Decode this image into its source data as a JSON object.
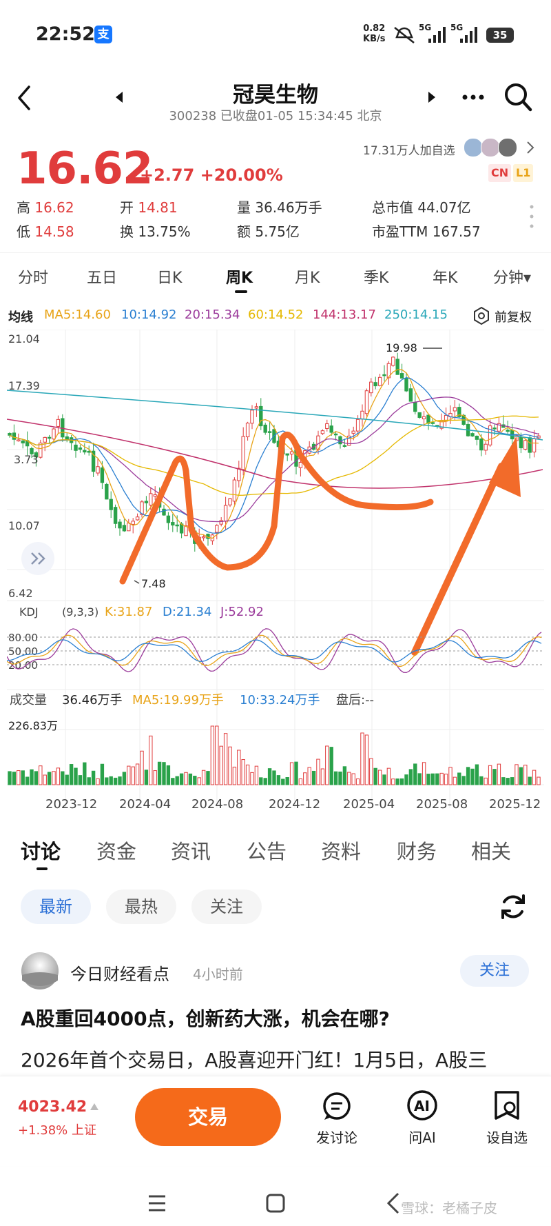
{
  "status_bar": {
    "time": "22:52",
    "app_badge": "支",
    "net_speed": "0.82",
    "net_unit": "KB/s",
    "signal_1": "5G",
    "signal_2": "5G",
    "battery": "35"
  },
  "header": {
    "title": "冠昊生物",
    "subtitle": "300238 已收盘01-05 15:34:45 北京"
  },
  "quote": {
    "price": "16.62",
    "change": "+2.77 +20.00%",
    "follow_count": "17.31万人加自选",
    "badge_cn": "CN",
    "badge_l1": "L1"
  },
  "stats": {
    "high_label": "高",
    "high": "16.62",
    "open_label": "开",
    "open": "14.81",
    "volume_label": "量",
    "volume": "36.46万手",
    "mktcap_label": "总市值",
    "mktcap": "44.07亿",
    "low_label": "低",
    "low": "14.58",
    "turnover_label": "换",
    "turnover": "13.75%",
    "amount_label": "额",
    "amount": "5.75亿",
    "pe_label": "市盈TTM",
    "pe": "167.57"
  },
  "period_tabs": [
    "分时",
    "五日",
    "日K",
    "周K",
    "月K",
    "季K",
    "年K",
    "分钟▾"
  ],
  "ma_legend": {
    "label": "均线",
    "ma5": "MA5:14.60",
    "ma10": "10:14.92",
    "ma20": "20:15.34",
    "ma60": "60:14.52",
    "ma144": "144:13.17",
    "ma250": "250:14.15",
    "adjust": "前复权"
  },
  "price_axis": {
    "p1": "21.04",
    "p2": "17.39",
    "p3": "3.73",
    "p4": "10.07",
    "p5": "6.42",
    "high_marker": "19.98",
    "low_marker": "7.48"
  },
  "kdj": {
    "label": "KDJ",
    "params": "(9,3,3)",
    "k": "K:31.87",
    "d": "D:21.34",
    "j": "J:52.92",
    "levels": [
      "80.00",
      "50.00",
      "20.00"
    ]
  },
  "volume_legend": {
    "label": "成交量",
    "value": "36.46万手",
    "ma5": "MA5:19.99万手",
    "ma10": "10:33.24万手",
    "after": "盘后:--",
    "max": "226.83万"
  },
  "date_axis": [
    "2023-12",
    "2024-04",
    "2024-08",
    "2024-12",
    "2025-04",
    "2025-08",
    "2025-12"
  ],
  "section_tabs": [
    "讨论",
    "资金",
    "资讯",
    "公告",
    "资料",
    "财务",
    "相关"
  ],
  "filter_pills": [
    "最新",
    "最热",
    "关注"
  ],
  "post": {
    "author": "今日财经看点",
    "time": "4小时前",
    "follow": "关注",
    "title": "A股重回4000点，创新药大涨，机会在哪?",
    "body": "2026年首个交易日，A股喜迎开门红！1月5日，A股三"
  },
  "index": {
    "value": "4023.42",
    "change": "+1.38% 上证"
  },
  "bottom_actions": {
    "trade": "交易",
    "discuss": "发讨论",
    "ask_ai": "问AI",
    "watchlist": "设自选"
  },
  "watermark": "雪球：老橘子皮",
  "colors": {
    "up": "#e03c3c",
    "down": "#2aa24a",
    "ma5": "#e8a317",
    "ma10": "#2a7fd1",
    "ma20": "#9b3b9b",
    "ma60": "#e5b800",
    "ma144": "#c0306a",
    "ma250": "#29a7b8",
    "annotation": "#f26b2a",
    "trade": "#f56a1a"
  }
}
